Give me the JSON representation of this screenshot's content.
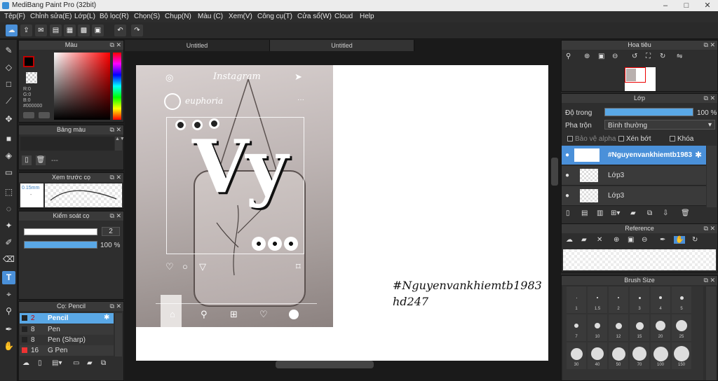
{
  "window": {
    "title": "MediBang Paint Pro (32bit)",
    "minimize": "–",
    "maximize": "□",
    "close": "✕"
  },
  "menu": [
    "Tệp(F)",
    "Chỉnh sửa(E)",
    "Lớp(L)",
    "Bộ lọc(R)",
    "Chọn(S)",
    "Chụp(N)",
    "Màu (C)",
    "Xem(V)",
    "Công cụ(T)",
    "Cửa sổ(W)",
    "Cloud",
    "Help"
  ],
  "tabs": [
    "Untitled",
    "Untitled"
  ],
  "color_panel": {
    "title": "Màu",
    "r": "R:0",
    "g": "G:0",
    "b": "B:0",
    "hex": "#000000",
    "fg": "#c00000",
    "picker_hue": "#ff0000"
  },
  "palette_panel": {
    "title": "Bảng màu",
    "dash": "---"
  },
  "brush_preview_panel": {
    "title": "Xem trước cọ",
    "size": "0.15mm",
    "dash": "-"
  },
  "brush_control_panel": {
    "title": "Kiểm soát cọ",
    "size_value": "2",
    "opacity_value": "100 %",
    "opacity_fraction": 1.0
  },
  "brush_list_panel": {
    "title": "Cọ: Pencil",
    "items": [
      {
        "size": "2",
        "name": "Pencil",
        "selected": true
      },
      {
        "size": "8",
        "name": "Pen",
        "selected": false
      },
      {
        "size": "8",
        "name": "Pen (Sharp)",
        "selected": false
      },
      {
        "size": "16",
        "name": "G Pen",
        "selected": false
      }
    ]
  },
  "canvas": {
    "insta_label": "Instagram",
    "username": "euphoria",
    "big_text": "Vy",
    "signature_line1": "#Nguyenvankhiemtb1983",
    "signature_line2": "hd247"
  },
  "navigator_panel": {
    "title": "Hoa tiêu"
  },
  "layer_panel": {
    "title": "Lớp",
    "opacity_label": "Độ trong",
    "opacity_value": "100 %",
    "opacity_fraction": 1.0,
    "blend_label": "Pha trộn",
    "blend_value": "Bình thường",
    "protect_alpha": "Bảo vệ alpha",
    "clipping": "Xén bớt",
    "lock": "Khóa",
    "layers": [
      {
        "name": "#Nguyenvankhiemtb1983",
        "selected": true
      },
      {
        "name": "Lớp3",
        "selected": false
      },
      {
        "name": "Lớp3",
        "selected": false
      }
    ]
  },
  "reference_panel": {
    "title": "Reference"
  },
  "brush_size_panel": {
    "title": "Brush Size",
    "sizes": [
      "1",
      "1.5",
      "2",
      "3",
      "4",
      "5",
      "7",
      "10",
      "12",
      "15",
      "20",
      "25",
      "30",
      "40",
      "50",
      "70",
      "100",
      "150"
    ]
  }
}
